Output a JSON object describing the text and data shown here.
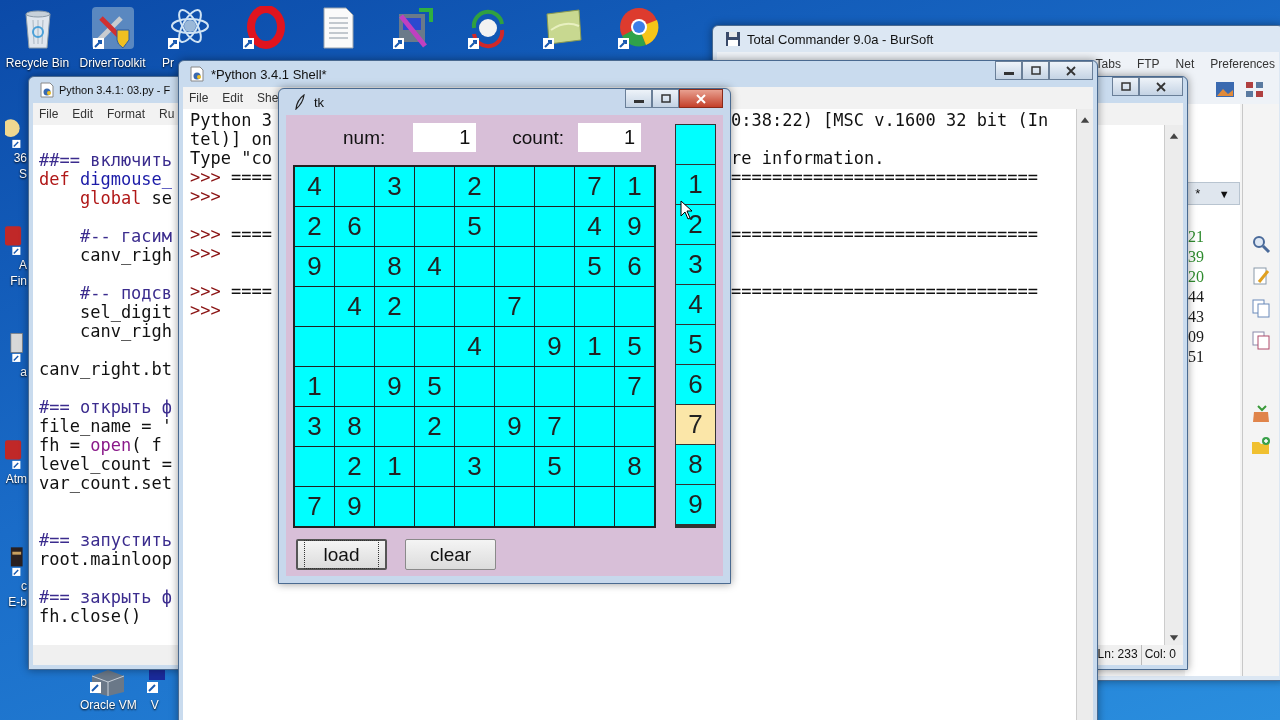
{
  "desktop": {
    "top_icons": [
      {
        "kind": "bin",
        "label": "Recycle Bin"
      },
      {
        "kind": "tools",
        "label": "DriverToolkit"
      },
      {
        "kind": "atom",
        "label": "Pr"
      },
      {
        "kind": "ring"
      },
      {
        "kind": "document"
      },
      {
        "kind": "package"
      },
      {
        "kind": "sync"
      },
      {
        "kind": "note"
      },
      {
        "kind": "wheel"
      }
    ],
    "left_icons": [
      {
        "kind": "photo",
        "lines": [
          "36",
          "S"
        ]
      },
      {
        "kind": "app",
        "lines": [
          "A",
          "Fin"
        ]
      },
      {
        "kind": "gray",
        "lines": [
          "a"
        ]
      },
      {
        "kind": "app",
        "lines": [
          "Atm"
        ]
      },
      {
        "kind": "book",
        "lines": [
          "c",
          "E-b"
        ]
      }
    ],
    "bottom_icons": [
      {
        "kind": "cube",
        "label": "Oracle VM"
      },
      {
        "kind": "dark",
        "label": "V"
      }
    ]
  },
  "total_commander": {
    "title": "Total Commander 9.0a - BurSoft",
    "menu": [
      "Tabs",
      "FTP",
      "Net",
      "Preferences"
    ],
    "filter": "*",
    "filter_arrow": "▼",
    "sizes": [
      {
        "text": "21",
        "color": "#2e8b2e"
      },
      {
        "text": "39",
        "color": "#2e8b2e"
      },
      {
        "text": "20",
        "color": "#2e8b2e"
      },
      {
        "text": "44",
        "color": "#1a1a1a"
      },
      {
        "text": "43",
        "color": "#1a1a1a"
      },
      {
        "text": "09",
        "color": "#1a1a1a"
      },
      {
        "text": "51",
        "color": "#1a1a1a"
      }
    ]
  },
  "editor": {
    "title": "Python 3.4.1: 03.py - F",
    "menu": [
      "File",
      "Edit",
      "Format",
      "Ru"
    ],
    "code": [
      {
        "kind": "code",
        "tokens": [
          {
            "t": "##== включить",
            "kind": "comment"
          }
        ]
      },
      {
        "kind": "code",
        "tokens": [
          {
            "t": "def ",
            "kind": "keyword"
          },
          {
            "t": "digmouse_",
            "kind": "name"
          }
        ]
      },
      {
        "kind": "code",
        "tokens": [
          {
            "t": "    global",
            "kind": "keyword"
          },
          {
            "t": " se",
            "kind": "plain"
          }
        ]
      },
      {
        "kind": "blank"
      },
      {
        "kind": "code",
        "tokens": [
          {
            "t": "    #-- гасим",
            "kind": "comment"
          }
        ]
      },
      {
        "kind": "code",
        "tokens": [
          {
            "t": "    canv_righ",
            "kind": "plain"
          }
        ]
      },
      {
        "kind": "blank"
      },
      {
        "kind": "code",
        "tokens": [
          {
            "t": "    #-- подсв",
            "kind": "comment"
          }
        ]
      },
      {
        "kind": "code",
        "tokens": [
          {
            "t": "    sel_digit",
            "kind": "plain"
          }
        ]
      },
      {
        "kind": "code",
        "tokens": [
          {
            "t": "    canv_righ",
            "kind": "plain"
          }
        ]
      },
      {
        "kind": "blank"
      },
      {
        "kind": "code",
        "tokens": [
          {
            "t": "canv_right.bt",
            "kind": "plain"
          }
        ]
      },
      {
        "kind": "blank"
      },
      {
        "kind": "code",
        "tokens": [
          {
            "t": "#== открыть ф",
            "kind": "comment"
          }
        ]
      },
      {
        "kind": "code",
        "tokens": [
          {
            "t": "file_name = '",
            "kind": "plain"
          }
        ]
      },
      {
        "kind": "code",
        "tokens": [
          {
            "t": "fh = ",
            "kind": "plain"
          },
          {
            "t": "open",
            "kind": "builtin"
          },
          {
            "t": "( f",
            "kind": "plain"
          }
        ]
      },
      {
        "kind": "code",
        "tokens": [
          {
            "t": "level_count =",
            "kind": "plain"
          }
        ]
      },
      {
        "kind": "code",
        "tokens": [
          {
            "t": "var_count.set",
            "kind": "plain"
          }
        ]
      },
      {
        "kind": "blank"
      },
      {
        "kind": "blank"
      },
      {
        "kind": "code",
        "tokens": [
          {
            "t": "#== запустить",
            "kind": "comment"
          }
        ]
      },
      {
        "kind": "code",
        "tokens": [
          {
            "t": "root.mainloop",
            "kind": "plain"
          }
        ]
      },
      {
        "kind": "blank"
      },
      {
        "kind": "code",
        "tokens": [
          {
            "t": "#== закрыть ф",
            "kind": "comment"
          }
        ]
      },
      {
        "kind": "code",
        "tokens": [
          {
            "t": "fh.close()",
            "kind": "plain"
          }
        ]
      }
    ],
    "line_status": "Ln: 233",
    "col_status": "Col: 0"
  },
  "shell": {
    "title": "*Python 3.4.1 Shell*",
    "menu": [
      "File",
      "Edit",
      "She"
    ],
    "lines": [
      {
        "kind": "text",
        "text": "Python 3",
        "right": "0:38:22) [MSC v.1600 32 bit (In"
      },
      {
        "kind": "text",
        "text": "tel)] on"
      },
      {
        "kind": "text",
        "text": "Type \"co",
        "right": "re information."
      },
      {
        "kind": "text",
        "prompt": ">>>",
        "text": " ====",
        "right": "=============================="
      },
      {
        "kind": "text",
        "prompt": ">>>"
      },
      {
        "kind": "blank"
      },
      {
        "kind": "text",
        "prompt": ">>>",
        "text": " ====",
        "right": "=============================="
      },
      {
        "kind": "text",
        "prompt": ">>>"
      },
      {
        "kind": "blank"
      },
      {
        "kind": "text",
        "prompt": ">>>",
        "text": " ====",
        "right": "=============================="
      },
      {
        "kind": "text",
        "prompt": ">>>"
      }
    ]
  },
  "tk": {
    "title": "tk",
    "num_label": "num:",
    "num_value": "1",
    "count_label": "count:",
    "count_value": "1",
    "grid": [
      [
        {
          "kind": "digit",
          "value": "4"
        },
        {
          "kind": "empty"
        },
        {
          "kind": "digit",
          "value": "3"
        },
        {
          "kind": "empty"
        },
        {
          "kind": "digit",
          "value": "2"
        },
        {
          "kind": "empty"
        },
        {
          "kind": "empty"
        },
        {
          "kind": "digit",
          "value": "7"
        },
        {
          "kind": "digit",
          "value": "1"
        }
      ],
      [
        {
          "kind": "digit",
          "value": "2"
        },
        {
          "kind": "digit",
          "value": "6"
        },
        {
          "kind": "empty"
        },
        {
          "kind": "empty"
        },
        {
          "kind": "digit",
          "value": "5"
        },
        {
          "kind": "empty"
        },
        {
          "kind": "empty"
        },
        {
          "kind": "digit",
          "value": "4"
        },
        {
          "kind": "digit",
          "value": "9"
        }
      ],
      [
        {
          "kind": "digit",
          "value": "9"
        },
        {
          "kind": "empty"
        },
        {
          "kind": "digit",
          "value": "8"
        },
        {
          "kind": "digit",
          "value": "4"
        },
        {
          "kind": "empty"
        },
        {
          "kind": "empty"
        },
        {
          "kind": "empty"
        },
        {
          "kind": "digit",
          "value": "5"
        },
        {
          "kind": "digit",
          "value": "6"
        }
      ],
      [
        {
          "kind": "empty"
        },
        {
          "kind": "digit",
          "value": "4"
        },
        {
          "kind": "digit",
          "value": "2"
        },
        {
          "kind": "empty"
        },
        {
          "kind": "empty"
        },
        {
          "kind": "digit",
          "value": "7"
        },
        {
          "kind": "empty"
        },
        {
          "kind": "empty"
        },
        {
          "kind": "empty"
        }
      ],
      [
        {
          "kind": "empty"
        },
        {
          "kind": "empty"
        },
        {
          "kind": "empty"
        },
        {
          "kind": "empty"
        },
        {
          "kind": "digit",
          "value": "4"
        },
        {
          "kind": "empty"
        },
        {
          "kind": "digit",
          "value": "9"
        },
        {
          "kind": "digit",
          "value": "1"
        },
        {
          "kind": "digit",
          "value": "5"
        }
      ],
      [
        {
          "kind": "digit",
          "value": "1"
        },
        {
          "kind": "empty"
        },
        {
          "kind": "digit",
          "value": "9"
        },
        {
          "kind": "digit",
          "value": "5"
        },
        {
          "kind": "empty"
        },
        {
          "kind": "empty"
        },
        {
          "kind": "empty"
        },
        {
          "kind": "empty"
        },
        {
          "kind": "digit",
          "value": "7"
        }
      ],
      [
        {
          "kind": "digit",
          "value": "3"
        },
        {
          "kind": "digit",
          "value": "8"
        },
        {
          "kind": "empty"
        },
        {
          "kind": "digit",
          "value": "2"
        },
        {
          "kind": "empty"
        },
        {
          "kind": "digit",
          "value": "9"
        },
        {
          "kind": "digit",
          "value": "7"
        },
        {
          "kind": "empty"
        },
        {
          "kind": "empty"
        }
      ],
      [
        {
          "kind": "empty"
        },
        {
          "kind": "digit",
          "value": "2"
        },
        {
          "kind": "digit",
          "value": "1"
        },
        {
          "kind": "empty"
        },
        {
          "kind": "digit",
          "value": "3"
        },
        {
          "kind": "empty"
        },
        {
          "kind": "digit",
          "value": "5"
        },
        {
          "kind": "empty"
        },
        {
          "kind": "digit",
          "value": "8"
        }
      ],
      [
        {
          "kind": "digit",
          "value": "7"
        },
        {
          "kind": "digit",
          "value": "9"
        },
        {
          "kind": "empty"
        },
        {
          "kind": "empty"
        },
        {
          "kind": "empty"
        },
        {
          "kind": "empty"
        },
        {
          "kind": "empty"
        },
        {
          "kind": "empty"
        },
        {
          "kind": "empty"
        }
      ]
    ],
    "digits": [
      {
        "selected": false
      },
      {
        "label": "1",
        "selected": false
      },
      {
        "label": "2",
        "selected": false
      },
      {
        "label": "3",
        "selected": false
      },
      {
        "label": "4",
        "selected": false
      },
      {
        "label": "5",
        "selected": false
      },
      {
        "label": "6",
        "selected": false
      },
      {
        "label": "7",
        "selected": true
      },
      {
        "label": "8",
        "selected": false
      },
      {
        "label": "9",
        "selected": false
      }
    ],
    "buttons": [
      {
        "label": "load",
        "focused": true
      },
      {
        "label": "clear",
        "focused": false
      }
    ]
  }
}
